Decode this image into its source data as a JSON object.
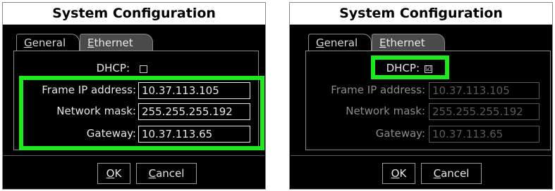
{
  "colors": {
    "highlight": "#1ee81e",
    "dialog_bg": "#000000",
    "title_bg": "#ffffff"
  },
  "left_dialog": {
    "title": "System Configuration",
    "tabs": [
      {
        "label": "General",
        "mnemonic": "G",
        "rest": "eneral"
      },
      {
        "label": "Ethernet",
        "mnemonic": "E",
        "rest": "thernet",
        "selected": true
      }
    ],
    "dhcp": {
      "label": "DHCP:",
      "checked": false,
      "glyph": ""
    },
    "frame_ip": {
      "label": "Frame IP address:",
      "value": "10.37.113.105"
    },
    "network_mask": {
      "label": "Network mask:",
      "value": "255.255.255.192"
    },
    "gateway": {
      "label": "Gateway:",
      "value": "10.37.113.65"
    },
    "ok": {
      "label": "OK",
      "mnemonic": "O",
      "rest": "K"
    },
    "cancel": {
      "label": "Cancel",
      "mnemonic": "C",
      "rest": "ancel"
    }
  },
  "right_dialog": {
    "title": "System Configuration",
    "tabs": [
      {
        "label": "General",
        "mnemonic": "G",
        "rest": "eneral"
      },
      {
        "label": "Ethernet",
        "mnemonic": "E",
        "rest": "thernet",
        "selected": true
      }
    ],
    "dhcp": {
      "label": "DHCP:",
      "checked": true,
      "glyph": "☑"
    },
    "frame_ip": {
      "label": "Frame IP address:",
      "value": "10.37.113.105"
    },
    "network_mask": {
      "label": "Network mask:",
      "value": "255.255.255.192"
    },
    "gateway": {
      "label": "Gateway:",
      "value": "10.37.113.65"
    },
    "ok": {
      "label": "OK",
      "mnemonic": "O",
      "rest": "K"
    },
    "cancel": {
      "label": "Cancel",
      "mnemonic": "C",
      "rest": "ancel"
    }
  }
}
